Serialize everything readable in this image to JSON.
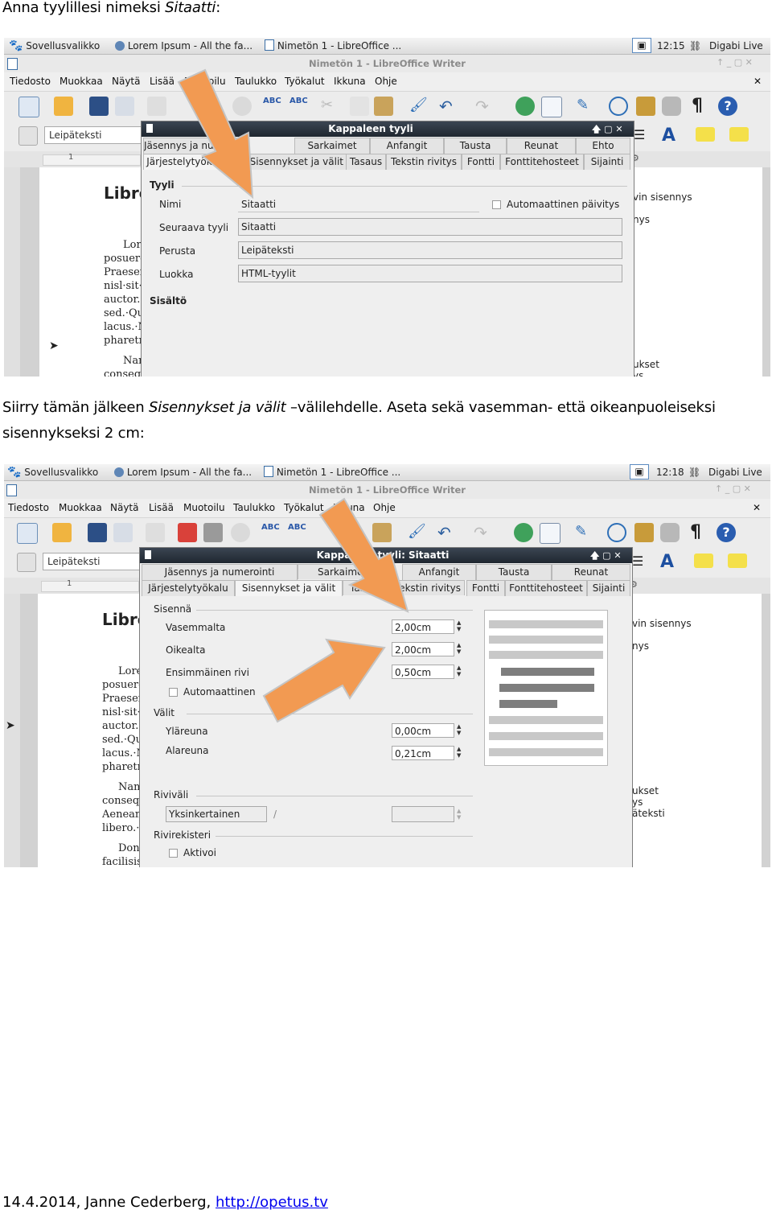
{
  "intro": {
    "prefix": "Anna tyylillesi nimeksi ",
    "emph": "Sitaatti",
    "suffix": ":"
  },
  "middle": {
    "p1": "Siirry tämän jälkeen ",
    "emph": "Sisennykset ja välit",
    "p2": " –välilehdelle. Aseta sekä vasemman- että oikeanpuoleiseksi",
    "line2": "sisennykseksi 2 cm:"
  },
  "footer": {
    "date_author": "14.4.2014, Janne Cederberg, ",
    "link": "http://opetus.tv"
  },
  "colors": {
    "arrow": "#f29a52",
    "arrow_edge": "#d07a38",
    "dialog_title": "#2a323c",
    "preview_light": "#c8c8c8",
    "preview_dark": "#7e7e7e"
  },
  "shot1": {
    "taskbar": {
      "menu": "Sovellusvalikko",
      "browser": "Lorem Ipsum - All the fa...",
      "writer": "Nimetön 1 - LibreOffice ...",
      "clock": "12:15",
      "live": "Digabi Live"
    },
    "window_title": "Nimetön 1 - LibreOffice Writer",
    "menus": [
      "Tiedosto",
      "Muokkaa",
      "Näytä",
      "Lisää",
      "Muotoilu",
      "Taulukko",
      "Työkalut",
      "Ikkuna",
      "Ohje"
    ],
    "style_box": "Leipäteksti",
    "ruler_mark": "1",
    "dialog_title": "Kappaleen tyyli",
    "tabs_row1": [
      "Jäsennys ja numerointi",
      "Sarkaimet",
      "Anfangit",
      "Tausta",
      "Reunat",
      "Ehto"
    ],
    "tabs_row2": [
      "Järjestelytyökalu",
      "Sisennykset ja välit",
      "Tasaus",
      "Tekstin rivitys",
      "Fontti",
      "Fonttitehosteet",
      "Sijainti"
    ],
    "section_style": "Tyyli",
    "labels": [
      "Nimi",
      "Seuraava tyyli",
      "Perusta",
      "Luokka"
    ],
    "values": [
      "Sitaatti",
      "Sitaatti",
      "Leipäteksti",
      "HTML-tyylit"
    ],
    "autoupdate": "Automaattinen päivitys",
    "section_content": "Sisältö",
    "doc_heading": "Libre",
    "doc_lines": [
      "Lore",
      "posuere",
      "Praesen",
      "nisl·sit·",
      "auctor.·",
      "sed.·Qu",
      "lacus.·N",
      "pharetra",
      "Nam",
      "consequ"
    ],
    "right_panel": [
      "vin sisennys",
      "nys",
      "ukset",
      "ys"
    ]
  },
  "shot2": {
    "taskbar": {
      "menu": "Sovellusvalikko",
      "browser": "Lorem Ipsum - All the fa...",
      "writer": "Nimetön 1 - LibreOffice ...",
      "clock": "12:18",
      "live": "Digabi Live"
    },
    "window_title": "Nimetön 1 - LibreOffice Writer",
    "menus": [
      "Tiedosto",
      "Muokkaa",
      "Näytä",
      "Lisää",
      "Muotoilu",
      "Taulukko",
      "Työkalut",
      "Ikkuna",
      "Ohje"
    ],
    "style_box": "Leipäteksti",
    "ruler_mark": "1",
    "dialog_title": "Kappaleen tyyli: Sitaatti",
    "tabs_row1": [
      "Jäsennys ja numerointi",
      "Sarkaimet",
      "Anfangit",
      "Tausta",
      "Reunat"
    ],
    "tabs_row2": [
      "Järjestelytyökalu",
      "Sisennykset ja välit",
      "Tasaus",
      "Tekstin rivitys",
      "Fontti",
      "Fonttitehosteet",
      "Sijainti"
    ],
    "section_indent": "Sisennä",
    "indent_labels": [
      "Vasemmalta",
      "Oikealta",
      "Ensimmäinen rivi"
    ],
    "indent_values": [
      "2,00cm",
      "2,00cm",
      "0,50cm"
    ],
    "auto": "Automaattinen",
    "section_spacing": "Välit",
    "spacing_labels": [
      "Yläreuna",
      "Alareuna"
    ],
    "spacing_values": [
      "0,00cm",
      "0,21cm"
    ],
    "section_line": "Riviväli",
    "line_value": "Yksinkertainen",
    "line_sep": "/",
    "section_register": "Rivirekisteri",
    "activate": "Aktivoi",
    "doc_heading": "Libre",
    "doc_lines": [
      "Lore",
      "posuere",
      "Praesen",
      "nisl·sit·",
      "auctor.·",
      "sed.·Qu",
      "lacus.·N",
      "pharetra",
      "Nam",
      "consequ",
      "Aenean",
      "libero.·",
      "Don",
      "facilisis"
    ],
    "right_panel": [
      "vin sisennys",
      "nys",
      "ukset",
      "ys",
      "äteksti"
    ]
  }
}
